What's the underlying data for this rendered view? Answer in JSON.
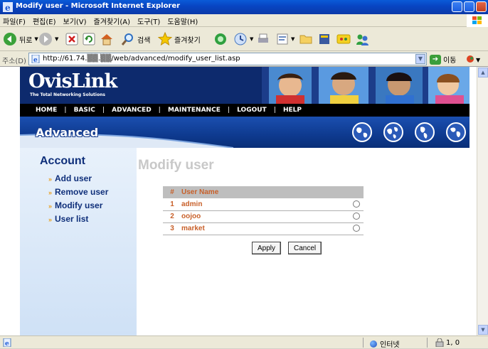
{
  "window": {
    "title": "Modify user - Microsoft Internet Explorer"
  },
  "menubar": {
    "items": [
      "파일(F)",
      "편집(E)",
      "보기(V)",
      "즐겨찾기(A)",
      "도구(T)",
      "도움말(H)"
    ]
  },
  "toolbar": {
    "back_label": "뒤로",
    "search_label": "검색",
    "favorites_label": "즐겨찾기"
  },
  "address": {
    "label": "주소(D)",
    "url": "http://61.74.▒▒.▒▒/web/advanced/modify_user_list.asp",
    "go_label": "이동"
  },
  "site": {
    "logo": "OvisLink",
    "tagline": "The Total Networking Solutions",
    "nav": [
      "HOME",
      "BASIC",
      "ADVANCED",
      "MAINTENANCE",
      "LOGOUT",
      "HELP"
    ],
    "section": "Advanced"
  },
  "sidebar": {
    "heading": "Account",
    "links": [
      "Add user",
      "Remove user",
      "Modify user",
      "User list"
    ]
  },
  "main": {
    "title": "Modify user",
    "table": {
      "headers": [
        "#",
        "User Name"
      ],
      "rows": [
        {
          "num": "1",
          "name": "admin"
        },
        {
          "num": "2",
          "name": "oojoo"
        },
        {
          "num": "3",
          "name": "market"
        }
      ]
    },
    "apply_label": "Apply",
    "cancel_label": "Cancel"
  },
  "status": {
    "zone": "인터넷",
    "count": "1, 0"
  },
  "colors": {
    "accent": "#0f2f7a",
    "table_text": "#c8602a"
  }
}
